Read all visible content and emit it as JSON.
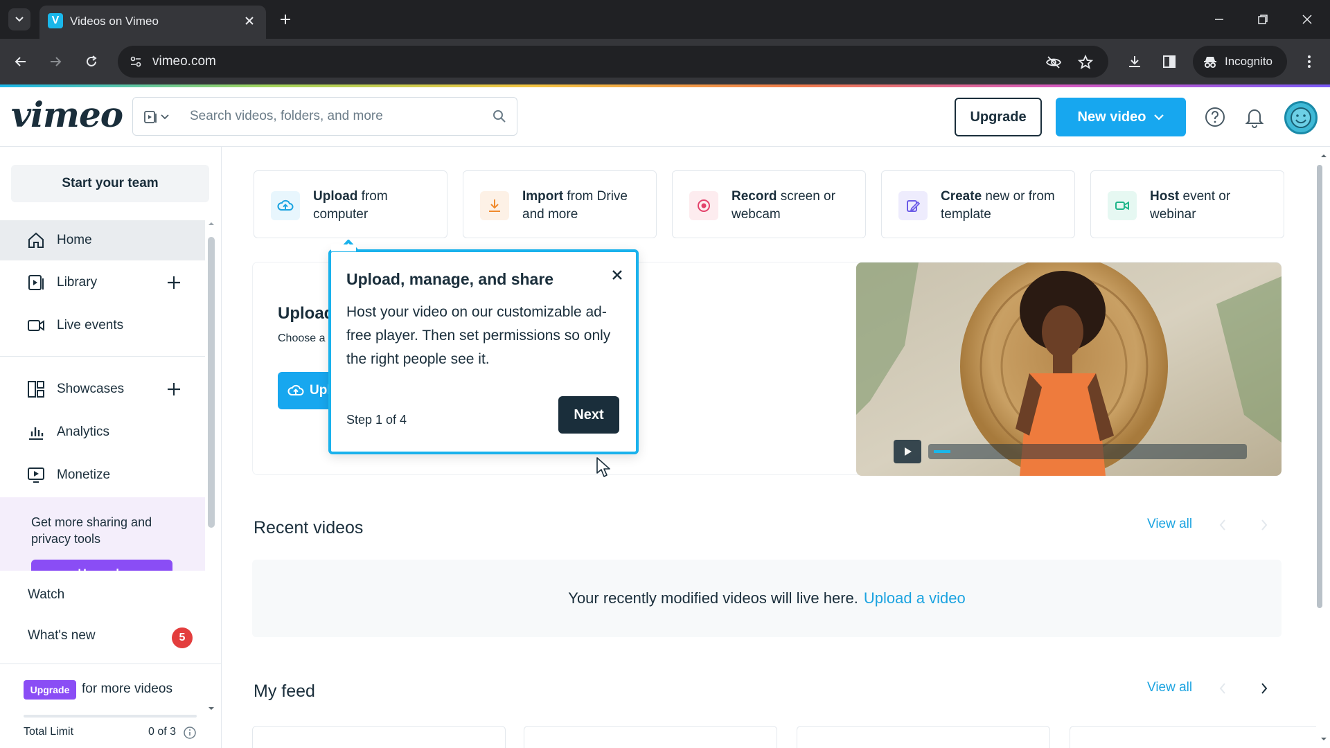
{
  "browser": {
    "tab_title": "Videos on Vimeo",
    "url": "vimeo.com",
    "incognito_label": "Incognito"
  },
  "header": {
    "logo": "vimeo",
    "search_placeholder": "Search videos, folders, and more",
    "upgrade_label": "Upgrade",
    "new_video_label": "New video"
  },
  "sidebar": {
    "start_team": "Start your team",
    "items": [
      {
        "label": "Home",
        "icon": "home-icon"
      },
      {
        "label": "Library",
        "icon": "library-icon"
      },
      {
        "label": "Live events",
        "icon": "live-events-icon"
      },
      {
        "label": "Showcases",
        "icon": "showcases-icon"
      },
      {
        "label": "Analytics",
        "icon": "analytics-icon"
      },
      {
        "label": "Monetize",
        "icon": "monetize-icon"
      }
    ],
    "promo_text": "Get more sharing and privacy tools",
    "promo_button": "Upgrade",
    "watch": "Watch",
    "whats_new": "What's new",
    "whats_new_count": "5",
    "upgrade_tag": "Upgrade",
    "more_videos": "for more videos",
    "total_limit_label": "Total Limit",
    "total_limit_value": "0 of 3"
  },
  "quick_actions": [
    {
      "bold": "Upload",
      "rest": " from computer",
      "icon": "cloud-upload-icon",
      "color": "#e8f6fd"
    },
    {
      "bold": "Import",
      "rest": " from Drive and more",
      "icon": "import-icon",
      "color": "#fdf1e6"
    },
    {
      "bold": "Record",
      "rest": " screen or webcam",
      "icon": "record-icon",
      "color": "#fdecef"
    },
    {
      "bold": "Create",
      "rest": " new or from template",
      "icon": "create-icon",
      "color": "#eeecfd"
    },
    {
      "bold": "Host",
      "rest": " event or webinar",
      "icon": "host-camera-icon",
      "color": "#e6f8f2"
    }
  ],
  "hero": {
    "title": "Upload",
    "subtitle": "Choose a share like",
    "button_label": "Upl"
  },
  "tooltip": {
    "title": "Upload, manage, and share",
    "body": "Host your video on our customizable ad-free player. Then set permissions so only the right people see it.",
    "step": "Step 1 of 4",
    "next_label": "Next"
  },
  "recent_videos": {
    "title": "Recent videos",
    "view_all": "View all",
    "empty_text": "Your recently modified videos will live here.",
    "empty_link": "Upload a video"
  },
  "my_feed": {
    "title": "My feed",
    "view_all": "View all"
  }
}
